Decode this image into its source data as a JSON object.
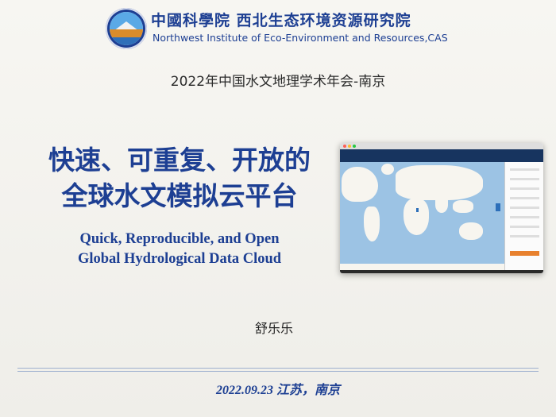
{
  "header": {
    "institute_cn": "中國科學院 西北生态环境资源研究院",
    "institute_en": "Northwest Institute of Eco-Environment and Resources,CAS"
  },
  "conference": "2022年中国水文地理学术年会-南京",
  "title_cn": [
    "快速、可重复、开放的",
    "全球水文模拟云平台"
  ],
  "title_en": [
    "Quick, Reproducible, and Open",
    "Global Hydrological Data Cloud"
  ],
  "author": "舒乐乐",
  "date_location": "2022.09.23 江苏，南京",
  "colors": {
    "brand": "#1d3f93",
    "background": "#f3f2ee",
    "rule": "#9fb0cf"
  },
  "icons": [
    "cas-logo-icon"
  ]
}
